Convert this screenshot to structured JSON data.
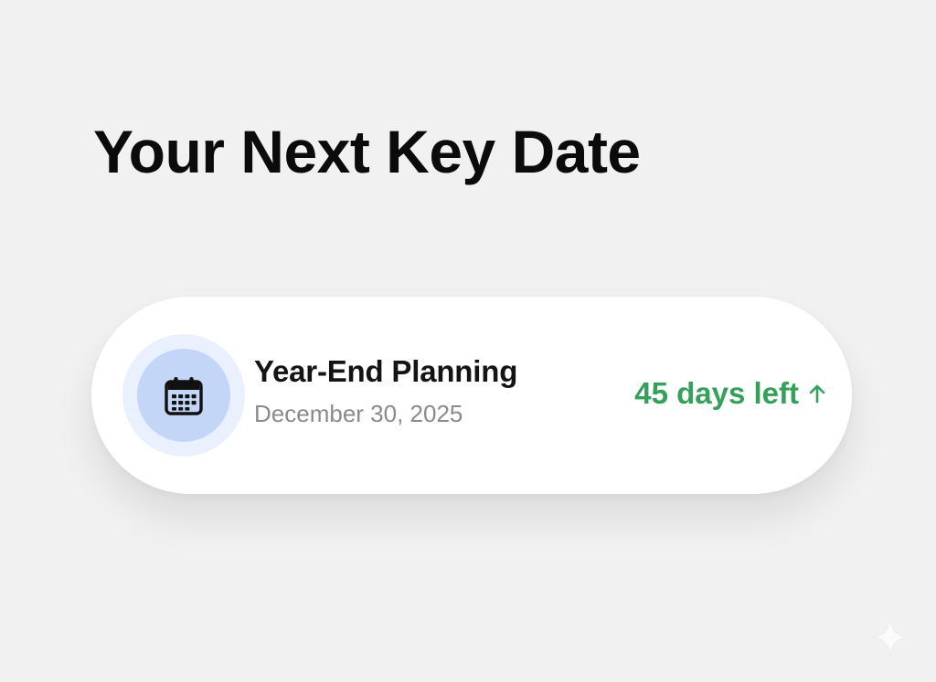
{
  "page": {
    "title": "Your Next Key Date"
  },
  "key_date": {
    "icon": "calendar-icon",
    "event_name": "Year-End Planning",
    "event_date": "December 30, 2025",
    "countdown_text": "45 days left",
    "countdown_icon": "arrow-up-icon"
  },
  "colors": {
    "background": "#f1f1f1",
    "card": "#ffffff",
    "icon_disc": "#c3d6f8",
    "icon_ring": "#eaf0fd",
    "countdown_green": "#35a05a",
    "secondary_text": "#8a8a8a"
  },
  "decorations": {
    "corner_mark_icon": "sparkle-icon"
  }
}
